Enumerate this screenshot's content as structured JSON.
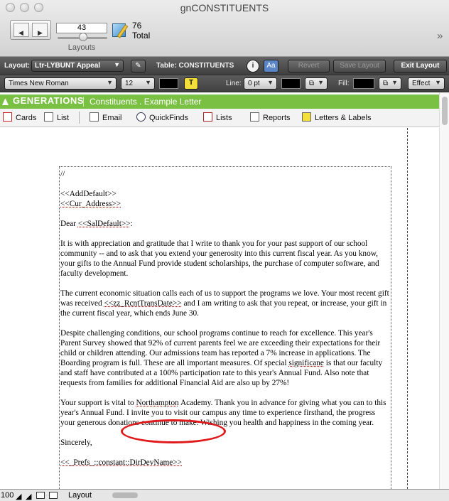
{
  "window": {
    "title": "gnCONSTITUENTS"
  },
  "toolbar": {
    "current_record": "43",
    "layouts_label": "Layouts",
    "record_total": "76",
    "total_label": "Total",
    "overflow_icon": "chevron-double-right-icon"
  },
  "layout_bar": {
    "layout_label": "Layout:",
    "layout_value": "Ltr-LYBUNT Appeal",
    "table_label": "Table: CONSTITUENTS",
    "revert_label": "Revert",
    "save_layout_label": "Save Layout",
    "exit_layout_label": "Exit Layout",
    "aa_label": "Aa",
    "info_label": "i"
  },
  "format_bar": {
    "font": "Times New Roman",
    "size": "12",
    "text_color_button": "T",
    "line_label": "Line:",
    "line_value": "0 pt",
    "fill_label": "Fill:",
    "effect_label": "Effect"
  },
  "banner": {
    "brand": "GENERATIONS",
    "title": "Constituents .  Example Letter",
    "color": "#7ac043"
  },
  "nav_tabs": [
    {
      "label": "Cards",
      "icon": "cards-icon"
    },
    {
      "label": "List",
      "icon": "list-icon"
    },
    {
      "label": "Email",
      "icon": "email-icon"
    },
    {
      "label": "QuickFinds",
      "icon": "magnifier-icon"
    },
    {
      "label": "Lists",
      "icon": "lists-icon"
    },
    {
      "label": "Reports",
      "icon": "reports-icon"
    },
    {
      "label": "Letters & Labels",
      "icon": "letters-icon"
    }
  ],
  "letter": {
    "line0": "//",
    "addr1": "<<AddDefault>>",
    "addr2": "<<Cur_Address>>",
    "salutation_pre": "Dear ",
    "salutation_field": "<<SalDefault>>",
    "salutation_post": ":",
    "p1": "It is with appreciation and gratitude that I write to thank you for your past support of our school community -- and to ask that you extend your generosity into this current fiscal year. As you know, your gifts to the Annual Fund provide student scholarships, the purchase of computer software, and faculty development.",
    "p2a": "The current economic situation calls each of us to support the programs we love. Your most recent gift was received ",
    "p2field": "<<zz_RcntTransDate>>",
    "p2b": " and I am writing to ask that you repeat, or increase, your gift in the current fiscal year, which ends June 30.",
    "p3a": "Despite challenging conditions, our school programs continue to reach for excellence. This year's Parent Survey showed that 92% of current parents feel we are exceeding their expectations for their child or children attending. Our admissions team has reported a 7% increase in applications. The Boarding program is full. These are all important measures. Of special ",
    "p3spell": "significane",
    "p3b": " is that our faculty and staff have contributed at a 100% participation rate to this year's Annual Fund.  Also note that requests from families for additional Financial Aid are also up by 27%!",
    "p4a": "Your support is vital to ",
    "p4spell": "Northampton",
    "p4b": " Academy. Thank you in advance for giving what you can to this year's Annual Fund. I invite you to visit our campus any time to experience firsthand, the progress your generous donations continue to make.  Wishing you health and happiness in the coming year.",
    "closing": "Sincerely,",
    "signature": "<<_Prefs_::constant::DirDevName>>"
  },
  "status_bar": {
    "zoom": "100",
    "mode": "Layout"
  }
}
